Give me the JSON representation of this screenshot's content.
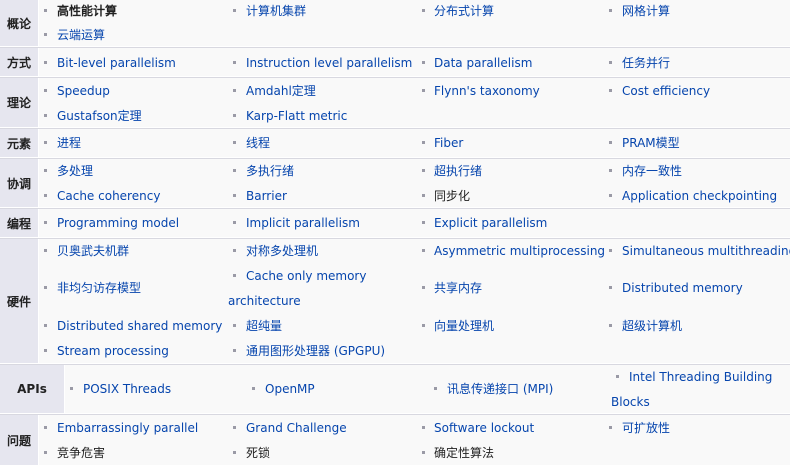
{
  "rows": [
    {
      "header": "概论",
      "items": [
        {
          "text": "高性能计算",
          "style": "plain"
        },
        {
          "text": "计算机集群"
        },
        {
          "text": "分布式计算"
        },
        {
          "text": "网格计算"
        },
        {
          "text": "云端运算"
        }
      ]
    },
    {
      "header": "方式",
      "items": [
        {
          "text": "Bit-level parallelism"
        },
        {
          "text": "Instruction level parallelism"
        },
        {
          "text": "Data parallelism"
        },
        {
          "text": "任务并行"
        }
      ]
    },
    {
      "header": "理论",
      "items": [
        {
          "text": "Speedup"
        },
        {
          "text": "Amdahl定理"
        },
        {
          "text": "Flynn's taxonomy"
        },
        {
          "text": "Cost efficiency"
        },
        {
          "text": "Gustafson定理"
        },
        {
          "text": "Karp-Flatt metric"
        }
      ]
    },
    {
      "header": "元素",
      "items": [
        {
          "text": "进程"
        },
        {
          "text": "线程"
        },
        {
          "text": "Fiber"
        },
        {
          "text": "PRAM模型"
        }
      ]
    },
    {
      "header": "协调",
      "items": [
        {
          "text": "多处理"
        },
        {
          "text": "多执行绪"
        },
        {
          "text": "超执行绪"
        },
        {
          "text": "内存一致性"
        },
        {
          "text": "Cache coherency"
        },
        {
          "text": "Barrier"
        },
        {
          "text": "同步化",
          "style": "black"
        },
        {
          "text": "Application checkpointing"
        }
      ]
    },
    {
      "header": "编程",
      "items": [
        {
          "text": "Programming model"
        },
        {
          "text": "Implicit parallelism"
        },
        {
          "text": "Explicit parallelism"
        }
      ]
    },
    {
      "header": "硬件",
      "items": [
        {
          "text": "贝奥武夫机群"
        },
        {
          "text": "对称多处理机"
        },
        {
          "text": "Asymmetric multiprocessing"
        },
        {
          "text": "Simultaneous multithreading"
        },
        {
          "text": "非均匀访存模型"
        },
        {
          "text": "Cache only memory"
        },
        {
          "text": "architecture"
        },
        {
          "text": "共享内存"
        },
        {
          "text": "Distributed memory"
        },
        {
          "text": "Distributed shared memory"
        },
        {
          "text": "超纯量"
        },
        {
          "text": "向量处理机"
        },
        {
          "text": "超级计算机"
        },
        {
          "text": "Stream processing"
        },
        {
          "text": "通用图形处理器 (GPGPU)"
        }
      ]
    },
    {
      "header": "APIs",
      "items": [
        {
          "text": "POSIX Threads"
        },
        {
          "text": "OpenMP"
        },
        {
          "text": "讯息传递接口 (MPI)"
        },
        {
          "text": "Intel Threading Building"
        },
        {
          "text": "Blocks"
        }
      ]
    },
    {
      "header": "问题",
      "items": [
        {
          "text": "Embarrassingly parallel"
        },
        {
          "text": "Grand Challenge"
        },
        {
          "text": "Software lockout"
        },
        {
          "text": "可扩放性"
        },
        {
          "text": "竞争危害",
          "style": "black"
        },
        {
          "text": "死锁",
          "style": "black"
        },
        {
          "text": "确定性算法",
          "style": "black"
        }
      ]
    }
  ],
  "colors": {
    "header_bg": "#e6e6ef",
    "body_bg": "#f9f9f9",
    "link": "#0645ad",
    "text": "#222222",
    "bullet": "#9a9aa6"
  }
}
